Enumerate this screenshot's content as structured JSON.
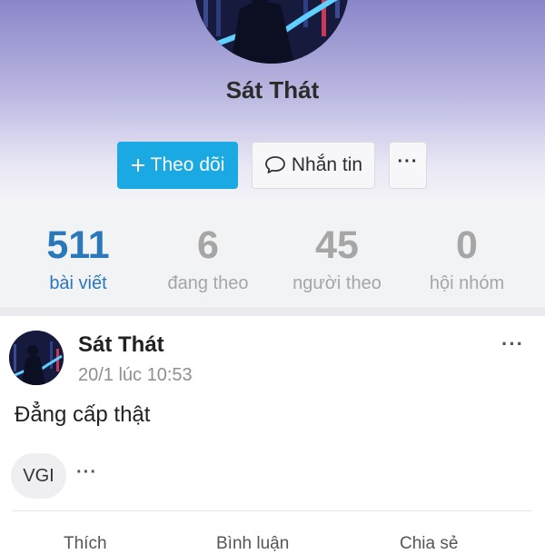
{
  "profile": {
    "name": "Sát Thát"
  },
  "buttons": {
    "follow": "Theo dõi",
    "message": "Nhắn tin",
    "more": "···"
  },
  "stats": [
    {
      "value": "511",
      "label": "bài viết"
    },
    {
      "value": "6",
      "label": "đang theo"
    },
    {
      "value": "45",
      "label": "người theo"
    },
    {
      "value": "0",
      "label": "hội nhóm"
    }
  ],
  "post": {
    "author": "Sát Thát",
    "time": "20/1 lúc 10:53",
    "menu": "···",
    "text": "Đẳng cấp thật",
    "tag": "VGI",
    "tag_more": "···"
  },
  "actions": [
    "Thích",
    "Bình luận",
    "Chia sẻ"
  ],
  "colors": {
    "accent": "#1aa9e2",
    "active_stat": "#2a77b9",
    "muted": "#a6a6a6"
  }
}
